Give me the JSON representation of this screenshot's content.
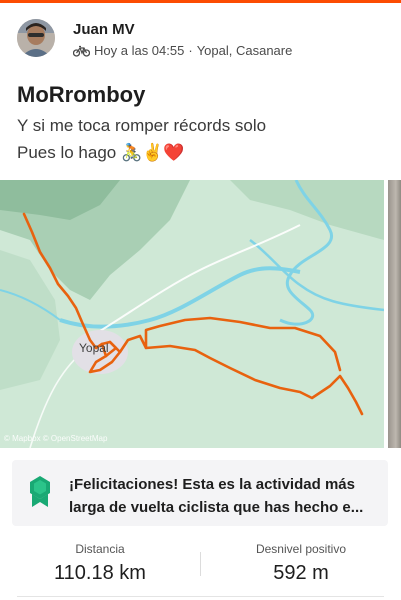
{
  "colors": {
    "brand": "#fc4c02",
    "route": "#e8620f",
    "map_land": "#cfe8d6",
    "map_water": "#7fd3e6",
    "achievement_bg": "#f4f4f6",
    "medal": "#19a974"
  },
  "header": {
    "athlete_name": "Juan MV",
    "activity_icon": "bike-icon",
    "timestamp": "Hoy a las 04:55",
    "separator": "·",
    "location": "Yopal, Casanare"
  },
  "activity": {
    "title": "MoRromboy",
    "description_line1": "Y si me toca romper récords solo",
    "description_line2": "Pues lo hago 🚴✌️❤️"
  },
  "map": {
    "town_label": "Yopal",
    "attribution": "© Mapbox © OpenStreetMap"
  },
  "achievement": {
    "icon": "medal-icon",
    "text": "¡Felicitaciones! Esta es la actividad más larga de vuelta ciclista que has hecho e..."
  },
  "stats": [
    {
      "label": "Distancia",
      "value": "110.18 km"
    },
    {
      "label": "Desnivel positivo",
      "value": "592 m"
    }
  ]
}
